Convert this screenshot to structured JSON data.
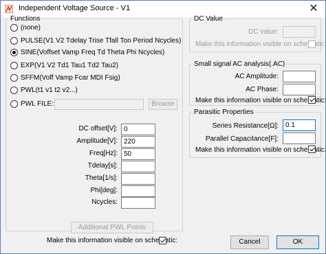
{
  "window": {
    "title": "Independent Voltage Source - V1"
  },
  "functions": {
    "legend": "Functions",
    "options": [
      {
        "label": "(none)",
        "selected": false
      },
      {
        "label": "PULSE(V1 V2 Tdelay Trise Tfall Ton Period Ncycles)",
        "selected": false
      },
      {
        "label": "SINE(Voffset Vamp Freq Td Theta Phi Ncycles)",
        "selected": true
      },
      {
        "label": "EXP(V1 V2 Td1 Tau1 Td2 Tau2)",
        "selected": false
      },
      {
        "label": "SFFM(Voff Vamp Fcar MDI Fsig)",
        "selected": false
      },
      {
        "label": "PWL(t1 v1 t2 v2...)",
        "selected": false
      },
      {
        "label": "PWL FILE:",
        "selected": false
      }
    ],
    "browse_label": "Browse",
    "params": [
      {
        "label": "DC offset[V]:",
        "value": "0"
      },
      {
        "label": "Amplitude[V]:",
        "value": "220"
      },
      {
        "label": "Freq[Hz]:",
        "value": "50"
      },
      {
        "label": "Tdelay[s]:",
        "value": ""
      },
      {
        "label": "Theta[1/s]:",
        "value": ""
      },
      {
        "label": "Phi[deg]:",
        "value": ""
      },
      {
        "label": "Ncycles:",
        "value": ""
      }
    ],
    "additional_pwl_label": "Additional PWL Points",
    "visible_label": "Make this information visible on schematic:",
    "visible_checked": true
  },
  "dc_value": {
    "legend": "DC Value",
    "field_label": "DC value:",
    "field_value": "",
    "visible_label": "Make this information visible on schematic:",
    "visible_checked": false
  },
  "ac_analysis": {
    "legend": "Small signal AC analysis(.AC)",
    "amplitude_label": "AC Amplitude:",
    "amplitude_value": "",
    "phase_label": "AC Phase:",
    "phase_value": "",
    "visible_label": "Make this information visible on schematic:",
    "visible_checked": true
  },
  "parasitic": {
    "legend": "Parasitic Properties",
    "series_label": "Series Resistance[Ω]:",
    "series_value": "0.1",
    "parallel_label": "Parallel Capacitance[F]:",
    "parallel_value": "",
    "visible_label": "Make this information visible on schematic:",
    "visible_checked": true
  },
  "buttons": {
    "cancel": "Cancel",
    "ok": "OK"
  },
  "colors": {
    "accent": "#0078d7",
    "app_icon": "#c0392b"
  }
}
